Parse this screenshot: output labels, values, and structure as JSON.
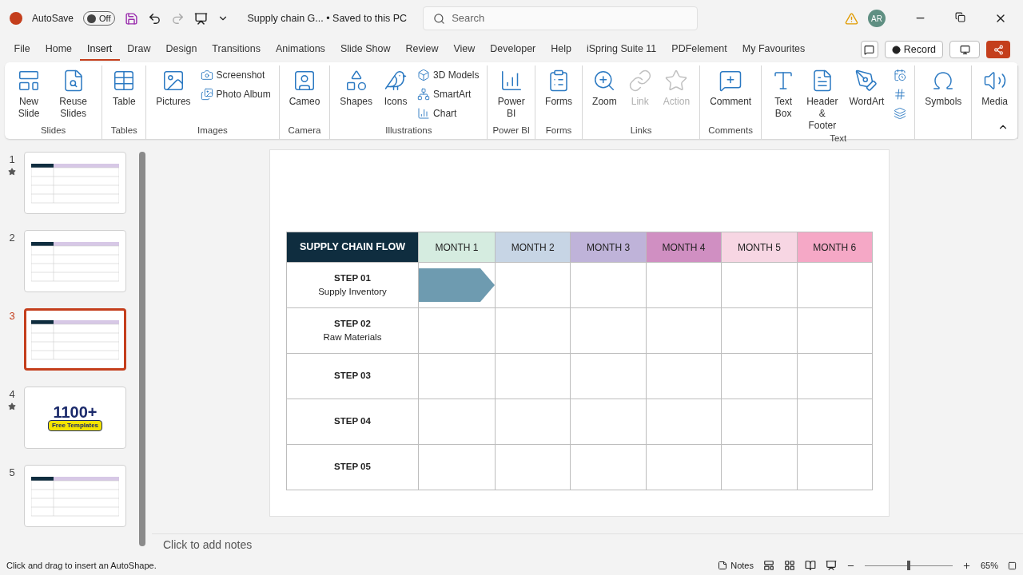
{
  "titlebar": {
    "autosave_label": "AutoSave",
    "autosave": {
      "label": "Off",
      "on": false
    },
    "document": "Supply chain G... • Saved to this PC",
    "search": {
      "placeholder": "Search"
    },
    "avatar": "AR"
  },
  "tabs": [
    {
      "label": "File",
      "selected": false
    },
    {
      "label": "Home",
      "selected": false
    },
    {
      "label": "Insert",
      "selected": true
    },
    {
      "label": "Draw",
      "selected": false
    },
    {
      "label": "Design",
      "selected": false
    },
    {
      "label": "Transitions",
      "selected": false
    },
    {
      "label": "Animations",
      "selected": false
    },
    {
      "label": "Slide Show",
      "selected": false
    },
    {
      "label": "Review",
      "selected": false
    },
    {
      "label": "View",
      "selected": false
    },
    {
      "label": "Developer",
      "selected": false
    },
    {
      "label": "Help",
      "selected": false
    },
    {
      "label": "iSpring Suite 11",
      "selected": false
    },
    {
      "label": "PDFelement",
      "selected": false
    },
    {
      "label": "My Favourites",
      "selected": false
    }
  ],
  "record_button": "Record",
  "ribbon": [
    {
      "name": "Slides",
      "buttons": [
        {
          "kind": "large",
          "label": "New Slide",
          "disabled": false
        },
        {
          "kind": "large",
          "label": "Reuse Slides",
          "disabled": false
        }
      ]
    },
    {
      "name": "Tables",
      "buttons": [
        {
          "kind": "large",
          "label": "Table",
          "disabled": false
        }
      ]
    },
    {
      "name": "Images",
      "buttons": [
        {
          "kind": "large",
          "label": "Pictures",
          "disabled": false
        },
        {
          "kind": "small",
          "label": "Screenshot",
          "disabled": false
        },
        {
          "kind": "small",
          "label": "Photo Album",
          "disabled": false
        }
      ]
    },
    {
      "name": "Camera",
      "buttons": [
        {
          "kind": "large",
          "label": "Cameo",
          "disabled": false
        }
      ]
    },
    {
      "name": "Illustrations",
      "buttons": [
        {
          "kind": "large",
          "label": "Shapes",
          "disabled": false
        },
        {
          "kind": "large",
          "label": "Icons",
          "disabled": false
        },
        {
          "kind": "small",
          "label": "3D Models",
          "disabled": false
        },
        {
          "kind": "small",
          "label": "SmartArt",
          "disabled": false
        },
        {
          "kind": "small",
          "label": "Chart",
          "disabled": false
        }
      ]
    },
    {
      "name": "Power BI",
      "buttons": [
        {
          "kind": "large",
          "label": "Power BI",
          "disabled": false
        }
      ]
    },
    {
      "name": "Forms",
      "buttons": [
        {
          "kind": "large",
          "label": "Forms",
          "disabled": false
        }
      ]
    },
    {
      "name": "Links",
      "buttons": [
        {
          "kind": "large",
          "label": "Zoom",
          "disabled": false
        },
        {
          "kind": "large",
          "label": "Link",
          "disabled": true
        },
        {
          "kind": "large",
          "label": "Action",
          "disabled": true
        }
      ]
    },
    {
      "name": "Comments",
      "buttons": [
        {
          "kind": "large",
          "label": "Comment",
          "disabled": false
        }
      ]
    },
    {
      "name": "Text",
      "buttons": [
        {
          "kind": "large",
          "label": "Text Box",
          "disabled": false
        },
        {
          "kind": "large",
          "label": "Header & Footer",
          "disabled": false
        },
        {
          "kind": "large",
          "label": "WordArt",
          "disabled": false
        },
        {
          "kind": "icon",
          "disabled": false
        },
        {
          "kind": "icon",
          "disabled": false
        },
        {
          "kind": "icon",
          "disabled": false
        }
      ]
    },
    {
      "buttons": [
        {
          "kind": "large",
          "label": "Symbols",
          "disabled": false
        }
      ]
    },
    {
      "buttons": [
        {
          "kind": "large",
          "label": "Media",
          "disabled": false
        }
      ]
    }
  ],
  "slides": [
    {
      "number": "1",
      "starred": true,
      "selected": false
    },
    {
      "number": "2",
      "starred": false,
      "selected": false
    },
    {
      "number": "3",
      "starred": false,
      "selected": true
    },
    {
      "number": "4",
      "starred": true,
      "selected": false,
      "headline": "1100+",
      "tagline": "Free Templates"
    },
    {
      "number": "5",
      "starred": false,
      "selected": false
    }
  ],
  "table": {
    "corner": "SUPPLY CHAIN FLOW",
    "columns": [
      {
        "label": "MONTH 1",
        "color": "#d5ece0"
      },
      {
        "label": "MONTH 2",
        "color": "#c7d5e5"
      },
      {
        "label": "MONTH 3",
        "color": "#bfb3d9"
      },
      {
        "label": "MONTH 4",
        "color": "#d08fc2"
      },
      {
        "label": "MONTH 5",
        "color": "#f7d6e3"
      },
      {
        "label": "MONTH 6",
        "color": "#f5a8c6"
      }
    ],
    "rows": [
      {
        "step": "STEP 01",
        "name": "Supply Inventory",
        "bars": [
          true,
          false,
          false,
          false,
          false,
          false
        ]
      },
      {
        "step": "STEP 02",
        "name": "Raw Materials",
        "bars": [
          false,
          false,
          false,
          false,
          false,
          false
        ]
      },
      {
        "step": "STEP 03",
        "bars": [
          false,
          false,
          false,
          false,
          false,
          false
        ]
      },
      {
        "step": "STEP 04",
        "bars": [
          false,
          false,
          false,
          false,
          false,
          false
        ]
      },
      {
        "step": "STEP 05",
        "bars": [
          false,
          false,
          false,
          false,
          false,
          false
        ]
      }
    ]
  },
  "notes_placeholder": "Click to add notes",
  "status": {
    "message": "Click and drag to insert an AutoShape.",
    "notes_button": "Notes",
    "zoom": {
      "level": 0.5,
      "reading": "65%"
    }
  }
}
